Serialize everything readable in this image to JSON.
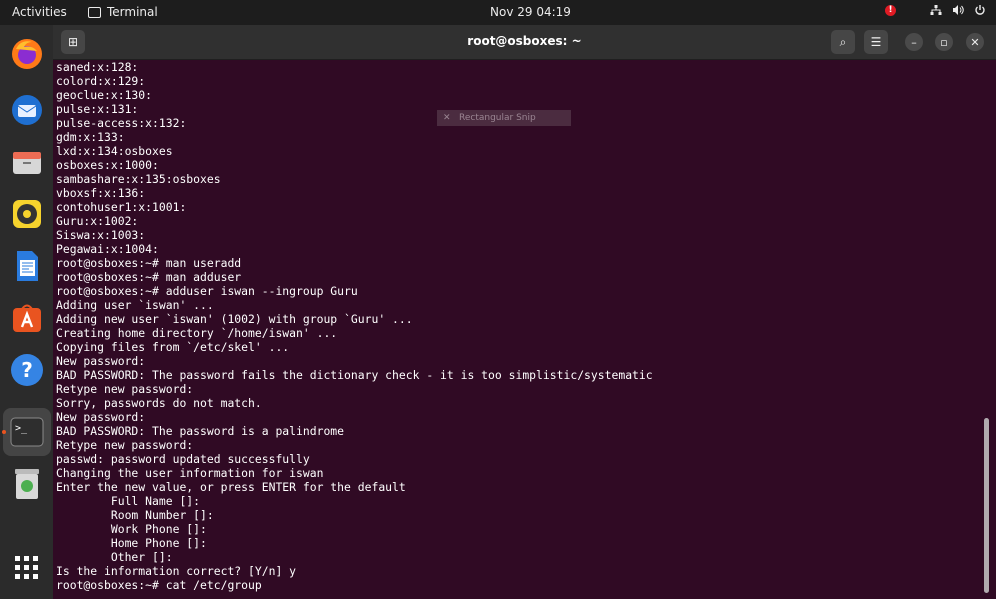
{
  "topbar": {
    "activities": "Activities",
    "app_name": "Terminal",
    "clock": "Nov 29  04:19",
    "alert": "!"
  },
  "window": {
    "title": "root@osboxes: ~",
    "new_tab_glyph": "⊞",
    "search_glyph": "⌕",
    "menu_glyph": "☰",
    "minimize_glyph": "–",
    "maximize_glyph": "▫",
    "close_glyph": "✕"
  },
  "snip_tooltip": {
    "label": "Rectangular Snip",
    "close": "✕"
  },
  "dock": {
    "apps": [
      "firefox-icon",
      "thunderbird-icon",
      "files-icon",
      "rhythmbox-icon",
      "writer-icon",
      "software-icon",
      "help-icon",
      "terminal-icon",
      "trash-icon",
      "show-apps-icon"
    ],
    "help_glyph": "?",
    "terminal_glyph": ">_"
  },
  "terminal": {
    "lines": [
      "saned:x:128:",
      "colord:x:129:",
      "geoclue:x:130:",
      "pulse:x:131:",
      "pulse-access:x:132:",
      "gdm:x:133:",
      "lxd:x:134:osboxes",
      "osboxes:x:1000:",
      "sambashare:x:135:osboxes",
      "vboxsf:x:136:",
      "contohuser1:x:1001:",
      "Guru:x:1002:",
      "Siswa:x:1003:",
      "Pegawai:x:1004:",
      "root@osboxes:~# man useradd",
      "root@osboxes:~# man adduser",
      "root@osboxes:~# adduser iswan --ingroup Guru",
      "Adding user `iswan' ...",
      "Adding new user `iswan' (1002) with group `Guru' ...",
      "Creating home directory `/home/iswan' ...",
      "Copying files from `/etc/skel' ...",
      "New password:",
      "BAD PASSWORD: The password fails the dictionary check - it is too simplistic/systematic",
      "Retype new password:",
      "Sorry, passwords do not match.",
      "New password:",
      "BAD PASSWORD: The password is a palindrome",
      "Retype new password:",
      "passwd: password updated successfully",
      "Changing the user information for iswan",
      "Enter the new value, or press ENTER for the default",
      "        Full Name []:",
      "        Room Number []:",
      "        Work Phone []:",
      "        Home Phone []:",
      "        Other []:",
      "Is the information correct? [Y/n] y",
      "root@osboxes:~# cat /etc/group"
    ]
  }
}
